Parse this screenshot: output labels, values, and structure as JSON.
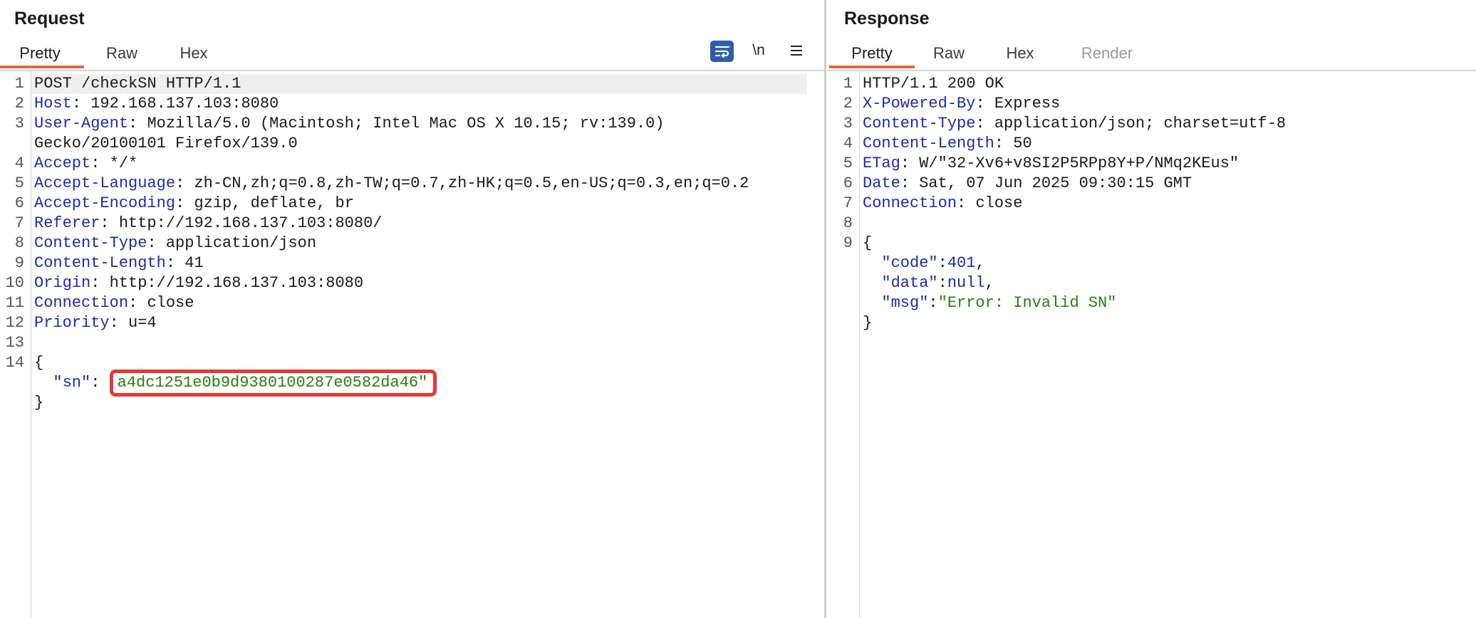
{
  "request": {
    "title": "Request",
    "tabs": [
      "Pretty",
      "Raw",
      "Hex"
    ],
    "active_tab": "Pretty",
    "toolbar": {
      "wrap_icon": "word-wrap-icon",
      "newline_label": "\\n",
      "menu_icon": "hamburger-menu-icon"
    },
    "line_numbers": [
      "1",
      "2",
      "3",
      "4",
      "5",
      "6",
      "7",
      "8",
      "9",
      "10",
      "11",
      "12",
      "13",
      "14"
    ],
    "request_line": "POST /checkSN HTTP/1.1",
    "headers": [
      {
        "name": "Host",
        "value": "192.168.137.103:8080"
      },
      {
        "name": "User-Agent",
        "value": "Mozilla/5.0 (Macintosh; Intel Mac OS X 10.15; rv:139.0)",
        "continuation": "Gecko/20100101 Firefox/139.0"
      },
      {
        "name": "Accept",
        "value": "*/*"
      },
      {
        "name": "Accept-Language",
        "value": "zh-CN,zh;q=0.8,zh-TW;q=0.7,zh-HK;q=0.5,en-US;q=0.3,en;q=0.2"
      },
      {
        "name": "Accept-Encoding",
        "value": "gzip, deflate, br"
      },
      {
        "name": "Referer",
        "value": "http://192.168.137.103:8080/"
      },
      {
        "name": "Content-Type",
        "value": "application/json"
      },
      {
        "name": "Content-Length",
        "value": "41"
      },
      {
        "name": "Origin",
        "value": "http://192.168.137.103:8080"
      },
      {
        "name": "Connection",
        "value": "close"
      },
      {
        "name": "Priority",
        "value": "u=4"
      }
    ],
    "body": {
      "open": "{",
      "sn_key": "\"sn\"",
      "sn_value": "a4dc1251e0b9d9380100287e0582da46\"",
      "close": "}"
    }
  },
  "response": {
    "title": "Response",
    "tabs": [
      "Pretty",
      "Raw",
      "Hex",
      "Render"
    ],
    "active_tab": "Pretty",
    "line_numbers": [
      "1",
      "2",
      "3",
      "4",
      "5",
      "6",
      "7",
      "8",
      "9"
    ],
    "status_line": "HTTP/1.1 200 OK",
    "headers": [
      {
        "name": "X-Powered-By",
        "value": "Express"
      },
      {
        "name": "Content-Type",
        "value": "application/json; charset=utf-8"
      },
      {
        "name": "Content-Length",
        "value": "50"
      },
      {
        "name": "ETag",
        "value": "W/\"32-Xv6+v8SI2P5RPp8Y+P/NMq2KEus\""
      },
      {
        "name": "Date",
        "value": "Sat, 07 Jun 2025 09:30:15 GMT"
      },
      {
        "name": "Connection",
        "value": "close"
      }
    ],
    "body": {
      "open": "{",
      "fields": [
        {
          "key": "\"code\"",
          "value": "401",
          "type": "number"
        },
        {
          "key": "\"data\"",
          "value": "null",
          "type": "null"
        },
        {
          "key": "\"msg\"",
          "value": "\"Error: Invalid SN\"",
          "type": "string"
        }
      ],
      "close": "}"
    }
  },
  "colors": {
    "accent_underline": "#e8663d",
    "header_name": "#1a2ca8",
    "json_string": "#2a7d14",
    "highlight_box": "#e53935",
    "wrap_button": "#2f5ea7"
  }
}
